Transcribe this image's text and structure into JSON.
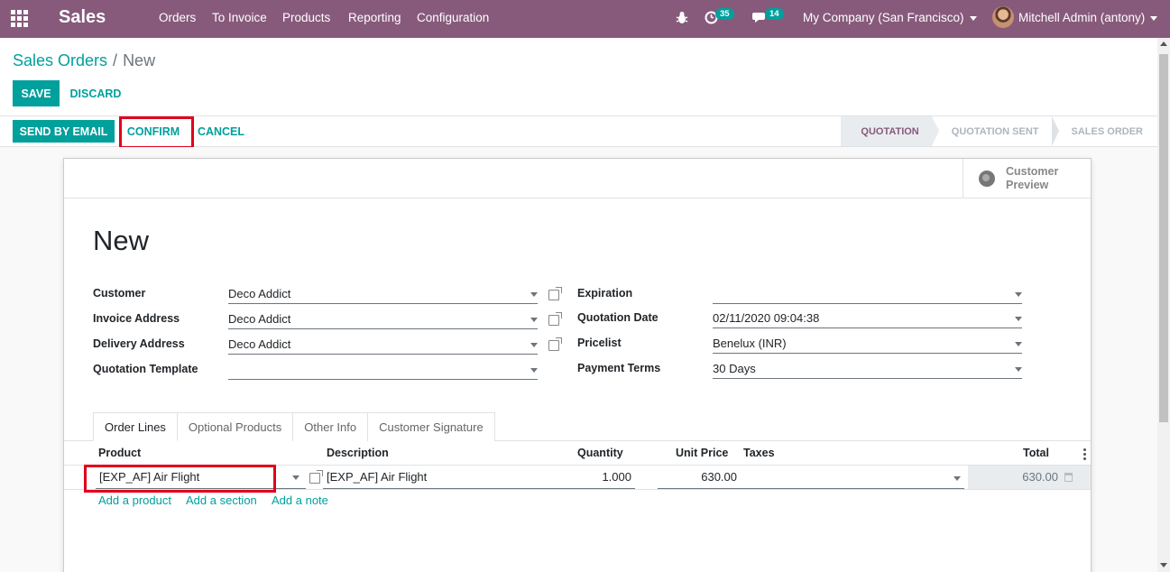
{
  "navbar": {
    "app_name": "Sales",
    "menus": [
      "Orders",
      "To Invoice",
      "Products",
      "Reporting",
      "Configuration"
    ],
    "activity_count": "35",
    "message_count": "14",
    "company": "My Company (San Francisco)",
    "user": "Mitchell Admin (antony)"
  },
  "breadcrumb": {
    "parent": "Sales Orders",
    "separator": "/",
    "current": "New"
  },
  "actions": {
    "save": "SAVE",
    "discard": "DISCARD"
  },
  "statusbar": {
    "send_email": "SEND BY EMAIL",
    "confirm": "CONFIRM",
    "cancel": "CANCEL",
    "stages": [
      "QUOTATION",
      "QUOTATION SENT",
      "SALES ORDER"
    ],
    "active_stage": "QUOTATION"
  },
  "preview": {
    "line1": "Customer",
    "line2": "Preview"
  },
  "form": {
    "title": "New",
    "left": [
      {
        "label": "Customer",
        "value": "Deco Addict"
      },
      {
        "label": "Invoice Address",
        "value": "Deco Addict"
      },
      {
        "label": "Delivery Address",
        "value": "Deco Addict"
      },
      {
        "label": "Quotation Template",
        "value": ""
      }
    ],
    "right": [
      {
        "label": "Expiration",
        "value": ""
      },
      {
        "label": "Quotation Date",
        "value": "02/11/2020 09:04:38"
      },
      {
        "label": "Pricelist",
        "value": "Benelux (INR)"
      },
      {
        "label": "Payment Terms",
        "value": "30 Days"
      }
    ]
  },
  "tabs": [
    "Order Lines",
    "Optional Products",
    "Other Info",
    "Customer Signature"
  ],
  "table": {
    "headers": [
      "Product",
      "Description",
      "Quantity",
      "Unit Price",
      "Taxes",
      "Total"
    ],
    "rows": [
      {
        "product": "[EXP_AF] Air Flight",
        "description": "[EXP_AF] Air Flight",
        "quantity": "1.000",
        "unit_price": "630.00",
        "taxes": "",
        "total": "630.00"
      }
    ],
    "add_links": [
      "Add a product",
      "Add a section",
      "Add a note"
    ]
  },
  "colors": {
    "brand": "#875a7b",
    "accent": "#00a09d",
    "highlight": "#e0001b"
  }
}
